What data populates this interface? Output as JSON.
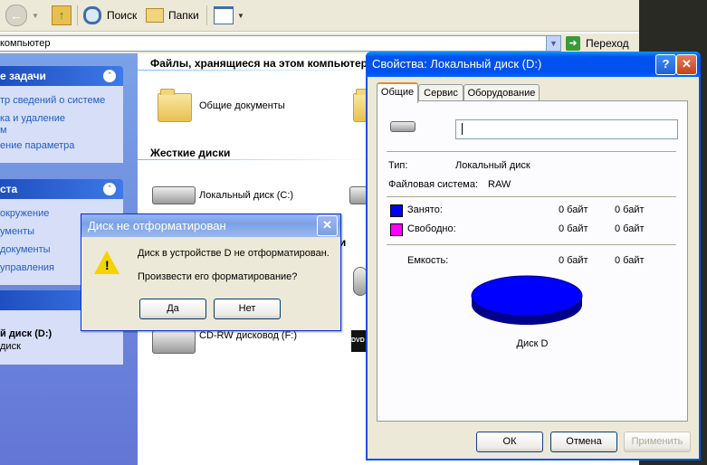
{
  "toolbar": {
    "search_label": "Поиск",
    "folders_label": "Папки"
  },
  "address": {
    "value": "компьютер",
    "go_label": "Переход"
  },
  "taskpane": {
    "groups": [
      {
        "title": "е задачи",
        "items": [
          "тр сведений о системе",
          "ка и удаление",
          "м",
          "ение параметра"
        ]
      },
      {
        "title": "ста",
        "items": [
          "окружение",
          "ументы",
          "документы",
          "управления"
        ]
      },
      {
        "title": "",
        "items": [
          "й диск (D:)",
          "диск"
        ]
      }
    ]
  },
  "content": {
    "shared_header": "Файлы, хранящиеся на этом компьютере",
    "shared_items": [
      "Общие документы"
    ],
    "hdd_header": "Жесткие диски",
    "hdd_items": [
      "Локальный диск (C:)"
    ],
    "removable_header_tail": "ми",
    "removable_items": [
      "CD-RW дисковод (F:)",
      "DVD"
    ]
  },
  "msgbox": {
    "title": "Диск не отформатирован",
    "message": "Диск в устройстве D не отформатирован.",
    "question": "Произвести его форматирование?",
    "yes_label": "Да",
    "no_label": "Нет"
  },
  "props": {
    "title": "Свойства: Локальный диск (D:)",
    "tabs": [
      "Общие",
      "Сервис",
      "Оборудование"
    ],
    "name_value": "",
    "type_label": "Тип:",
    "type_value": "Локальный диск",
    "fs_label": "Файловая система:",
    "fs_value": "RAW",
    "used_label": "Занято:",
    "used_bytes": "0 байт",
    "used_size": "0 байт",
    "free_label": "Свободно:",
    "free_bytes": "0 байт",
    "free_size": "0 байт",
    "cap_label": "Емкость:",
    "cap_bytes": "0 байт",
    "cap_size": "0 байт",
    "disk_caption": "Диск D",
    "ok_label": "ОК",
    "cancel_label": "Отмена",
    "apply_label": "Применить"
  },
  "colors": {
    "used": "#0000ff",
    "free": "#ff00ff",
    "accent": "#0054e3"
  },
  "icons": [
    "back-icon",
    "forward-icon",
    "up-folder-icon",
    "search-icon",
    "folders-icon",
    "views-icon",
    "go-icon",
    "warning-icon",
    "drive-icon",
    "folder-icon",
    "help-icon",
    "close-icon"
  ]
}
